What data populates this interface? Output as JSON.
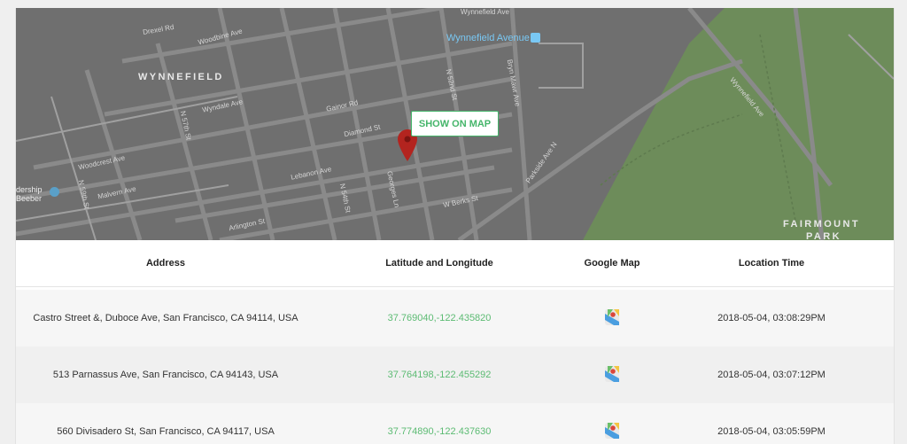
{
  "map": {
    "show_button": "SHOW ON MAP",
    "areas": [
      "WYNNEFIELD",
      "FAIRMOUNT",
      "PARK"
    ],
    "station": "Wynnefield Avenue",
    "streets": {
      "wynnefield_ave_top": "Wynnefield Ave",
      "woodbine": "Woodbine Ave",
      "drexel": "Drexel Rd",
      "wyndale": "Wyndale Ave",
      "gainor": "Gainor Rd",
      "diamond": "Diamond St",
      "lebanon": "Lebanon Ave",
      "n54": "N 54th St",
      "n52": "N 52nd St",
      "n57": "N 57th St",
      "n59": "N 59th St",
      "bryn_mawr": "Bryn Mawr Ave",
      "parkside": "Parkside Ave N",
      "wynnefield_ave_right": "Wynnefield Ave",
      "w_berks": "W Berks St",
      "arlington": "Arlington St",
      "georges_ln": "Georges Ln",
      "woodcrest": "Woodcrest Ave",
      "malvern": "Malvern Ave",
      "poi_partial": "dership Beeber"
    },
    "colors": {
      "park": "#6d8c5a",
      "overlay": "#6e6e6e",
      "accent": "#45b56a",
      "pin": "#b3241f"
    }
  },
  "table": {
    "headers": [
      "Address",
      "Latitude and Longitude",
      "Google Map",
      "Location Time"
    ],
    "rows": [
      {
        "address": "Castro Street &, Duboce Ave, San Francisco, CA 94114, USA",
        "latlng": "37.769040,-122.435820",
        "time": "2018-05-04,  03:08:29PM",
        "icon": "google-maps-icon"
      },
      {
        "address": "513 Parnassus Ave, San Francisco, CA 94143, USA",
        "latlng": "37.764198,-122.455292",
        "time": "2018-05-04,  03:07:12PM",
        "icon": "google-maps-icon"
      },
      {
        "address": "560 Divisadero St, San Francisco, CA 94117, USA",
        "latlng": "37.774890,-122.437630",
        "time": "2018-05-04,  03:05:59PM",
        "icon": "google-maps-icon"
      }
    ]
  }
}
